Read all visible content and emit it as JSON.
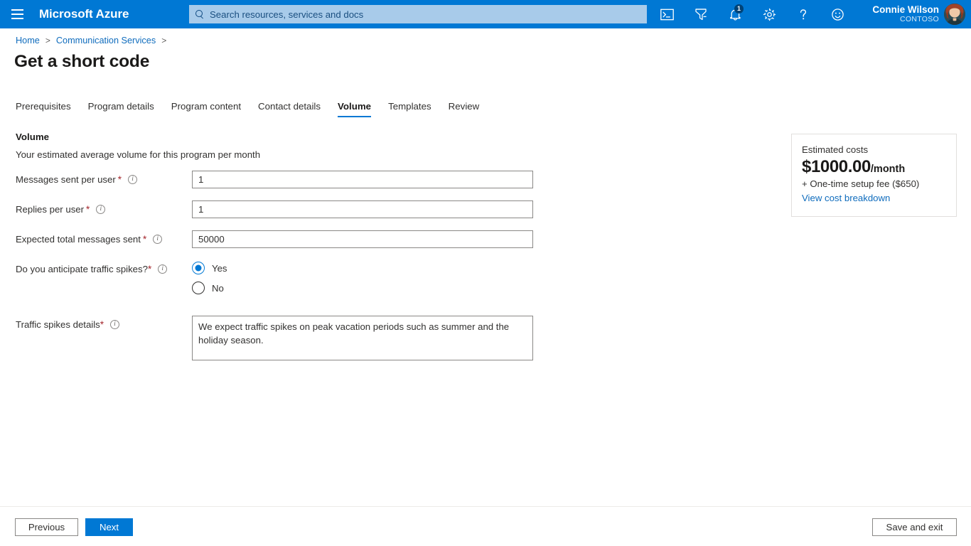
{
  "header": {
    "menu_icon": "hamburger-icon",
    "brand": "Microsoft Azure",
    "search": {
      "icon": "search-icon",
      "placeholder": "Search resources, services and docs",
      "value": ""
    },
    "icons": [
      {
        "name": "cloud-shell-icon",
        "label": "Cloud Shell"
      },
      {
        "name": "directory-filter-icon",
        "label": "Directories + subscriptions"
      },
      {
        "name": "notifications-bell-icon",
        "label": "Notifications",
        "badge": "1"
      },
      {
        "name": "settings-gear-icon",
        "label": "Settings"
      },
      {
        "name": "help-question-icon",
        "label": "Help"
      },
      {
        "name": "feedback-smiley-icon",
        "label": "Feedback"
      }
    ],
    "user": {
      "name": "Connie Wilson",
      "org": "CONTOSO",
      "avatar": "user-avatar"
    },
    "accent_color": "#0078d4",
    "search_bg": "#a8cbea"
  },
  "breadcrumb": {
    "items": [
      "Home",
      "Communication Services"
    ],
    "separator": ">"
  },
  "page": {
    "title": "Get a short code"
  },
  "tabs": [
    {
      "label": "Prerequisites",
      "active": false
    },
    {
      "label": "Program details",
      "active": false
    },
    {
      "label": "Program content",
      "active": false
    },
    {
      "label": "Contact details",
      "active": false
    },
    {
      "label": "Volume",
      "active": true
    },
    {
      "label": "Templates",
      "active": false
    },
    {
      "label": "Review",
      "active": false
    }
  ],
  "form": {
    "section_title": "Volume",
    "section_subtitle": "Your estimated average volume for this program per month",
    "fields": {
      "messages_sent": {
        "label": "Messages sent per user",
        "required_mark": "*",
        "info_icon": "info-circle-icon",
        "value": "1"
      },
      "replies": {
        "label": "Replies per user",
        "required_mark": "*",
        "info_icon": "info-circle-icon",
        "value": "1"
      },
      "expected_total": {
        "label": "Expected total messages sent",
        "required_mark": "*",
        "info_icon": "info-circle-icon",
        "value": "50000"
      },
      "traffic_spikes": {
        "label": "Do you anticipate traffic spikes?",
        "required_mark": "*",
        "info_icon": "info-circle-icon",
        "options": [
          {
            "label": "Yes",
            "selected": true
          },
          {
            "label": "No",
            "selected": false
          }
        ]
      },
      "spikes_details": {
        "label": "Traffic spikes details",
        "required_mark": "*",
        "info_icon": "info-circle-icon",
        "value": "We expect traffic spikes on peak vacation periods such as summer and the holiday season."
      }
    }
  },
  "cost_card": {
    "heading": "Estimated costs",
    "amount": "$1000.00",
    "period": "/month",
    "setup_fee": "+ One-time setup fee ($650)",
    "link": "View cost breakdown",
    "link_color": "#0f6cbd"
  },
  "footer": {
    "previous": "Previous",
    "next": "Next",
    "save_and_exit": "Save and exit",
    "primary_color": "#0078d4"
  }
}
